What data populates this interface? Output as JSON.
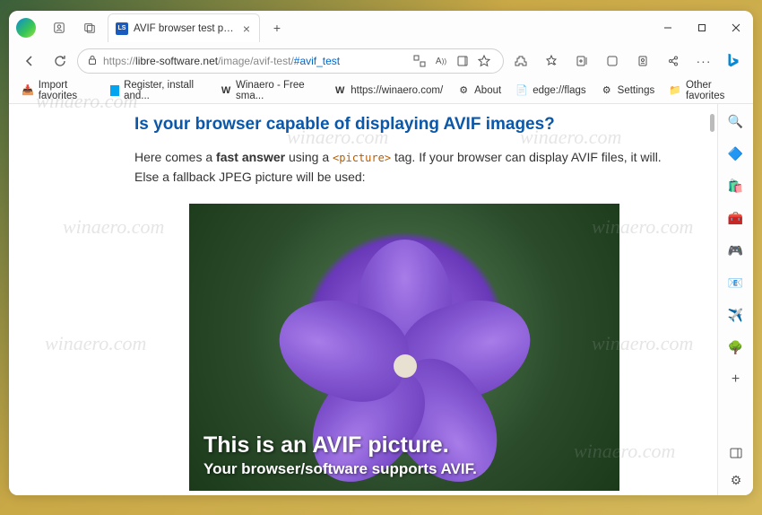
{
  "tab": {
    "favicon": "LS",
    "title": "AVIF browser test page: AVIF su"
  },
  "url": {
    "protocol": "https://",
    "host": "libre-software.net",
    "path": "/image/avif-test/",
    "hash": "#avif_test"
  },
  "bookmarks": {
    "items": [
      {
        "label": "Import favorites"
      },
      {
        "label": "Register, install and..."
      },
      {
        "label": "Winaero - Free sma..."
      },
      {
        "label": "https://winaero.com/"
      },
      {
        "label": "About"
      },
      {
        "label": "edge://flags"
      },
      {
        "label": "Settings"
      }
    ],
    "other": "Other favorites"
  },
  "page": {
    "heading": "Is your browser capable of displaying AVIF images?",
    "p_part1": "Here comes a ",
    "p_bold": "fast answer",
    "p_part2": " using a ",
    "p_code": "<picture>",
    "p_part3": " tag. If your browser can display AVIF files, it will. Else a fallback JPEG picture will be used:",
    "img_line1": "This is an AVIF picture.",
    "img_line2": "Your browser/software supports AVIF."
  },
  "watermark": "winaero.com"
}
